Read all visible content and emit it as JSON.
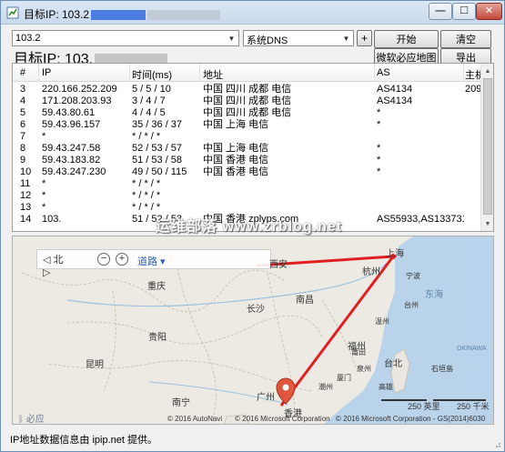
{
  "window": {
    "title_prefix": "目标IP: 103.2",
    "minimize_glyph": "—",
    "maximize_glyph": "☐",
    "close_glyph": "✕"
  },
  "controls": {
    "host_value": "103.2",
    "dns_value": "系统DNS",
    "plus_label": "+",
    "start_label": "开始",
    "clear_label": "清空",
    "map_label": "微软必应地图",
    "export_label": "导出"
  },
  "target_label": "目标IP:  103.",
  "table": {
    "columns": [
      "#",
      "IP",
      "时间(ms)",
      "地址",
      "AS",
      "主机"
    ],
    "rows": [
      {
        "no": "3",
        "ip": "220.166.252.209",
        "time": "5 / 5 / 10",
        "addr": "中国 四川 成都 电信",
        "as": "AS4134",
        "host": "209"
      },
      {
        "no": "4",
        "ip": "171.208.203.93",
        "time": "3 / 4 / 7",
        "addr": "中国 四川 成都 电信",
        "as": "AS4134",
        "host": ""
      },
      {
        "no": "5",
        "ip": "59.43.80.61",
        "time": "4 / 4 / 5",
        "addr": "中国 四川 成都 电信",
        "as": "*",
        "host": ""
      },
      {
        "no": "6",
        "ip": "59.43.96.157",
        "time": "35 / 36 / 37",
        "addr": "中国 上海 电信",
        "as": "*",
        "host": ""
      },
      {
        "no": "7",
        "ip": "*",
        "time": "* / * / *",
        "addr": "",
        "as": "",
        "host": ""
      },
      {
        "no": "8",
        "ip": "59.43.247.58",
        "time": "52 / 53 / 57",
        "addr": "中国 上海 电信",
        "as": "*",
        "host": ""
      },
      {
        "no": "9",
        "ip": "59.43.183.82",
        "time": "51 / 53 / 58",
        "addr": "中国 香港 电信",
        "as": "*",
        "host": ""
      },
      {
        "no": "10",
        "ip": "59.43.247.230",
        "time": "49 / 50 / 115",
        "addr": "中国 香港 电信",
        "as": "*",
        "host": ""
      },
      {
        "no": "11",
        "ip": "*",
        "time": "* / * / *",
        "addr": "",
        "as": "",
        "host": ""
      },
      {
        "no": "12",
        "ip": "*",
        "time": "* / * / *",
        "addr": "",
        "as": "",
        "host": ""
      },
      {
        "no": "13",
        "ip": "*",
        "time": "* / * / *",
        "addr": "",
        "as": "",
        "host": ""
      },
      {
        "no": "14",
        "ip": "103.",
        "time": "51 / 52 / 53",
        "addr": "中国 香港 zplyps.com",
        "as": "AS55933,AS133731",
        "host": ""
      }
    ]
  },
  "map": {
    "toolbar": {
      "compass": "北",
      "zoom_out": "−",
      "zoom_in": "+",
      "road_label": "道路 ▾"
    },
    "cities": [
      "西安",
      "重庆",
      "长沙",
      "南昌",
      "杭州",
      "上海",
      "福州",
      "贵阳",
      "昆明",
      "南宁",
      "广州",
      "香港",
      "台北"
    ],
    "seas": [
      "东海"
    ],
    "small_labels": [
      "宁波",
      "台州",
      "温州",
      "莆田",
      "泉州",
      "厦门",
      "高雄",
      "潮州",
      "OKINAWA",
      "石垣島"
    ],
    "copyright_1": "© 2016 AutoNavi",
    "copyright_2": "© 2016 Microsoft Corporation",
    "copyright_3": "© 2016 Microsoft Corporation - GS(2014)6030",
    "scale_km": "250 英里",
    "scale_mi": "250 千米",
    "bing_label": "必应",
    "route_color": "#e02020"
  },
  "watermark": "运维部落 www.zrblog.net",
  "status": "IP地址数据信息由 ipip.net 提供。"
}
